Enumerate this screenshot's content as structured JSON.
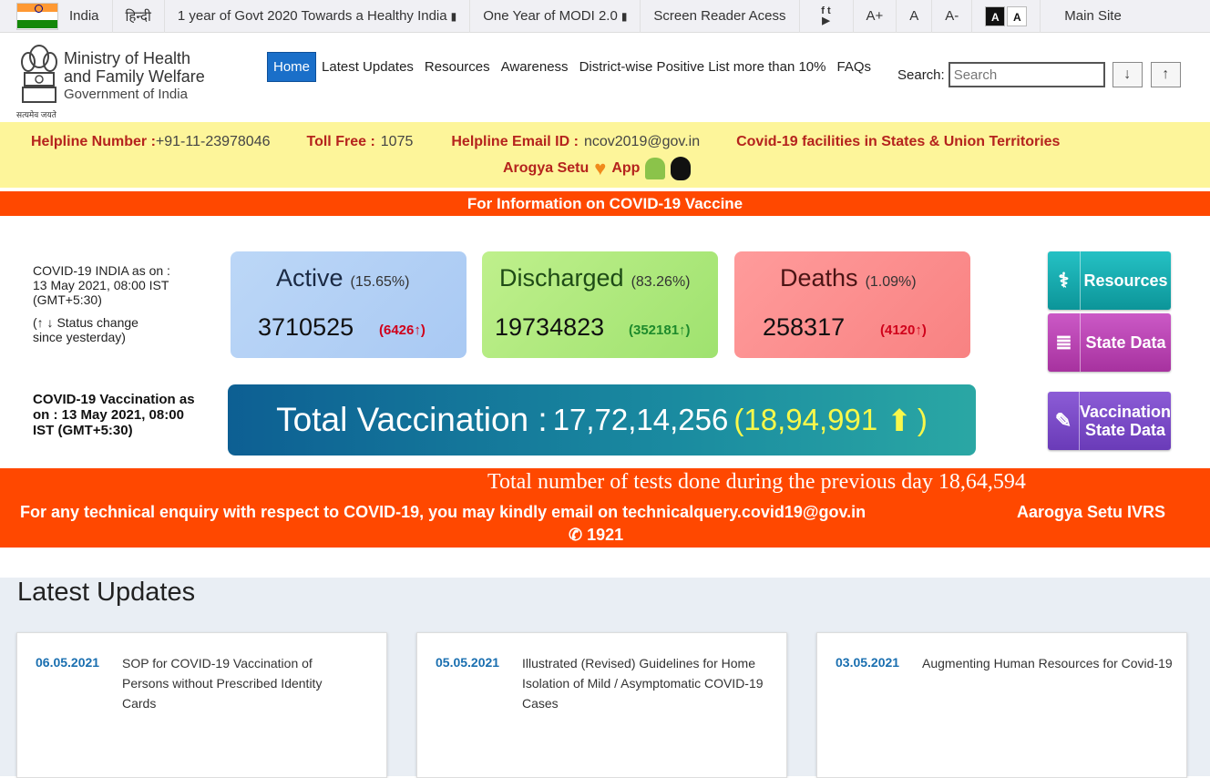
{
  "topbar": {
    "country": "India",
    "hindi": "हिन्दी",
    "link1": "1 year of Govt 2020 Towards a Healthy India",
    "link2": "One Year of MODI 2.0",
    "screen_reader": "Screen Reader Acess",
    "font_increase": "A+",
    "font_normal": "A",
    "font_decrease": "A-",
    "contrast_dark": "A",
    "contrast_light": "A",
    "main_site": "Main Site",
    "flag_colors": [
      "#ff9933",
      "#ffffff",
      "#138808"
    ]
  },
  "header": {
    "ministry_line1": "Ministry of Health",
    "ministry_line2": "and Family Welfare",
    "government": "Government of India",
    "emblem_motto": "सत्यमेव जयते"
  },
  "nav": {
    "items": [
      "Home",
      "Latest Updates",
      "Resources",
      "Awareness",
      "District-wise Positive List more than 10%",
      "FAQs"
    ],
    "search_label": "Search:",
    "search_placeholder": "Search",
    "down_arrow": "↓",
    "up_arrow": "↑"
  },
  "helpline": {
    "helpline_label": "Helpline Number :",
    "helpline_value": "+91-11-23978046",
    "tollfree_label": "Toll Free :",
    "tollfree_value": "1075",
    "email_label": "Helpline Email ID :",
    "email_value": "ncov2019@gov.in",
    "facilities": "Covid-19 facilities in States & Union Territories",
    "arogya": "Arogya Setu",
    "app": "App"
  },
  "vaccine_banner": "For Information on COVID-19 Vaccine",
  "stats": {
    "asof": "COVID-19 INDIA as on : 13 May 2021, 08:00 IST (GMT+5:30)",
    "status_note": "(↑ ↓ Status change since yesterday)",
    "vacc_asof": "COVID-19 Vaccination as on : 13 May 2021, 08:00 IST (GMT+5:30)",
    "active": {
      "title": "Active",
      "pct": "(15.65%)",
      "value": "3710525",
      "change": "(6426↑)",
      "color": "#d0021b"
    },
    "discharged": {
      "title": "Discharged",
      "pct": "(83.26%)",
      "value": "19734823",
      "change": "(352181↑)",
      "color": "#1e8a2c"
    },
    "deaths": {
      "title": "Deaths",
      "pct": "(1.09%)",
      "value": "258317",
      "change": "(4120↑)",
      "color": "#d0021b"
    }
  },
  "vaccination": {
    "label": "Total Vaccination :",
    "value": "17,72,14,256",
    "change": "(18,94,991",
    "close": ")"
  },
  "side": {
    "resources": "Resources",
    "state_data": "State Data",
    "vacc_state_line1": "Vaccination",
    "vacc_state_line2": "State Data"
  },
  "tests": {
    "line1": "Total number of tests done during the previous day 18,64,594",
    "line2": "For any technical enquiry with respect to COVID-19, you may kindly email on technicalquery.covid19@gov.in",
    "ivrs": "Aarogya Setu IVRS",
    "phone": "1921"
  },
  "latest": {
    "heading": "Latest Updates",
    "items": [
      {
        "date": "06.05.2021",
        "title": "SOP for COVID-19 Vaccination of Persons without Prescribed Identity Cards"
      },
      {
        "date": "05.05.2021",
        "title": "Illustrated (Revised) Guidelines for Home Isolation of Mild / Asymptomatic COVID-19 Cases"
      },
      {
        "date": "03.05.2021",
        "title": "Augmenting Human Resources for Covid-19"
      }
    ]
  }
}
